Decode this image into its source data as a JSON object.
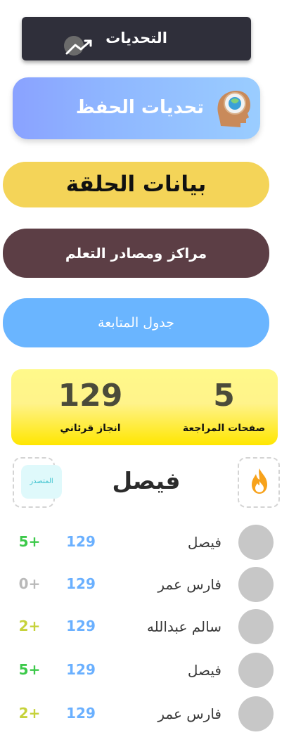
{
  "challenges_bar": {
    "label": "التحديات"
  },
  "memo_button": {
    "label": "تحديات الحفظ"
  },
  "halaqa_button": {
    "label": "بيانات الحلقة"
  },
  "centers_button": {
    "label": "مراكز ومصادر التعلم"
  },
  "schedule_button": {
    "label": "جدول المتابعة"
  },
  "stats": {
    "review_pages": {
      "value": "5",
      "label": "صفحات المراجعة"
    },
    "achievement": {
      "value": "129",
      "label": "انجاز قرئاني"
    }
  },
  "top_user": {
    "name": "فيصل",
    "leader_badge": "المتصدر"
  },
  "ranking": [
    {
      "name": "فيصل",
      "score": "129",
      "delta": "5+",
      "delta_color": "#3cc94a"
    },
    {
      "name": "فارس عمر",
      "score": "129",
      "delta": "0+",
      "delta_color": "#b9b9b9"
    },
    {
      "name": "سالم عبدالله",
      "score": "129",
      "delta": "2+",
      "delta_color": "#c6d23a"
    },
    {
      "name": "فيصل",
      "score": "129",
      "delta": "5+",
      "delta_color": "#3cc94a"
    },
    {
      "name": "فارس عمر",
      "score": "129",
      "delta": "2+",
      "delta_color": "#c6d23a"
    }
  ],
  "icons": {
    "challenges": "chart-trend-icon",
    "memo": "brain-head-icon",
    "fire": "fire-icon"
  },
  "colors": {
    "dark_bar": "#2f2f3a",
    "halaqa": "#f4d458",
    "centers": "#5c3e45",
    "schedule": "#6ab5ff",
    "score": "#6ab0ff"
  }
}
